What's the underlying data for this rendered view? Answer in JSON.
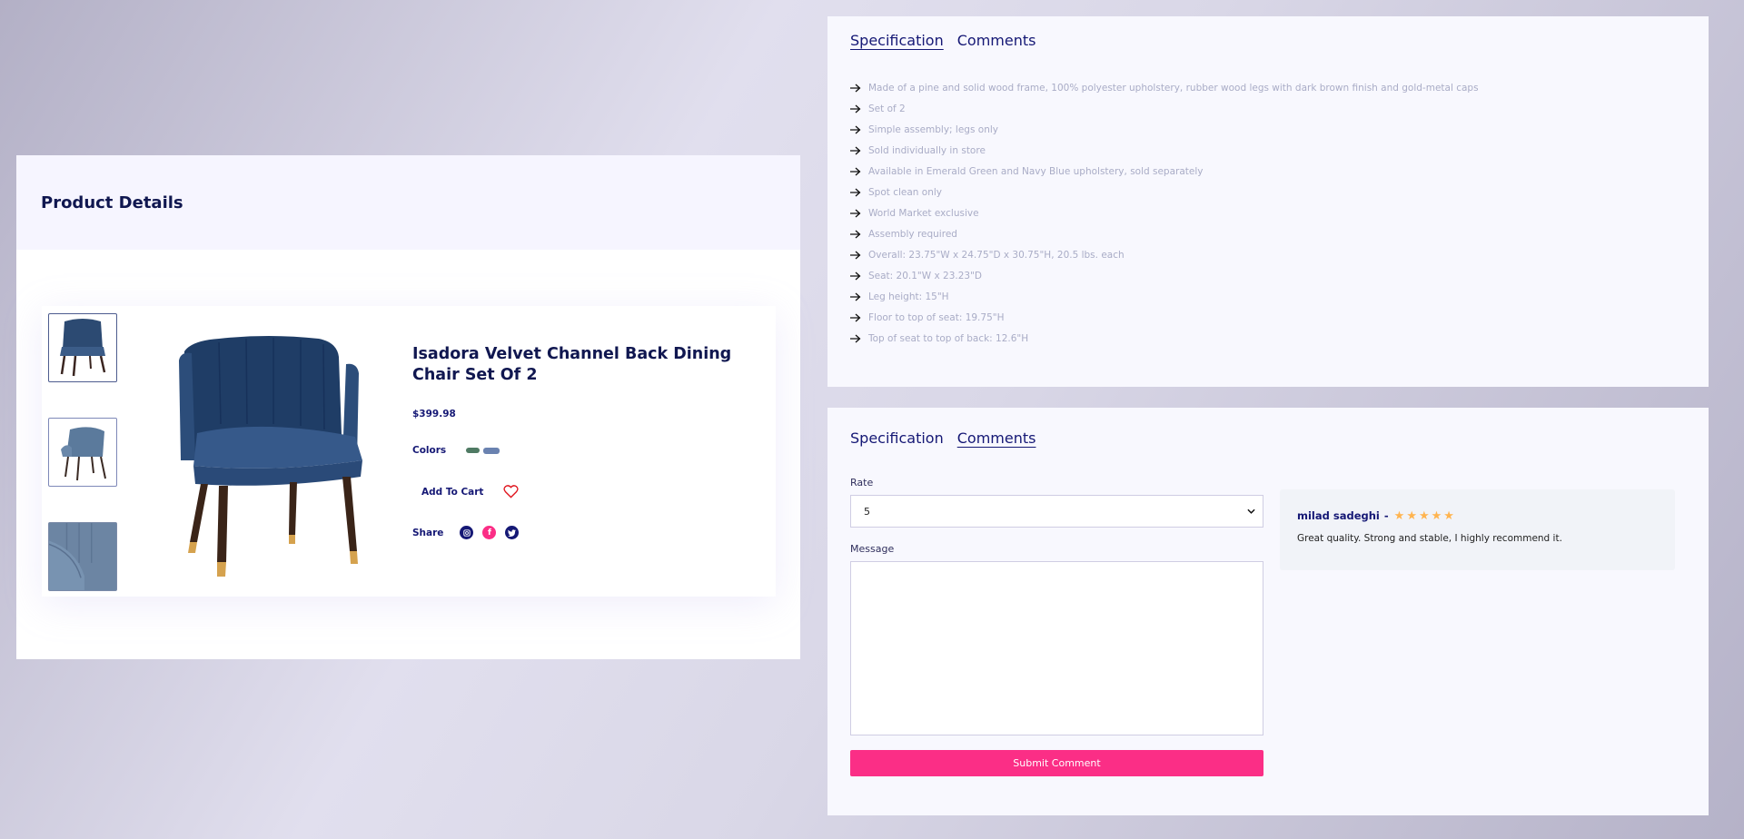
{
  "product_panel": {
    "title": "Product Details",
    "product": {
      "name": "Isadora Velvet Channel Back Dining Chair Set Of 2",
      "price": "$399.98",
      "colors_label": "Colors",
      "colors": [
        "#4f7a63",
        "#6a82b0"
      ],
      "add_to_cart_label": "Add To Cart",
      "share_label": "Share",
      "thumbnails": [
        "front-view",
        "back-view",
        "closeup-view"
      ],
      "wishlist_color": "#e0141d",
      "social_colors": {
        "instagram": "#151875",
        "facebook": "#fb2e86",
        "twitter": "#151875"
      }
    }
  },
  "spec_panel": {
    "tabs": [
      {
        "label": "Specification",
        "active": true
      },
      {
        "label": "Comments",
        "active": false
      }
    ],
    "items": [
      "Made of a pine and solid wood frame, 100% polyester upholstery, rubber wood legs with dark brown finish and gold-metal caps",
      "Set of 2",
      "Simple assembly; legs only",
      "Sold individually in store",
      "Available in Emerald Green and Navy Blue upholstery, sold separately",
      "Spot clean only",
      "World Market exclusive",
      "Assembly required",
      "Overall: 23.75\"W x 24.75\"D x 30.75\"H, 20.5 lbs. each",
      "Seat: 20.1\"W x 23.23\"D",
      "Leg height: 15\"H",
      "Floor to top of seat: 19.75\"H",
      "Top of seat to top of back: 12.6\"H"
    ]
  },
  "comments_panel": {
    "tabs": [
      {
        "label": "Specification",
        "active": false
      },
      {
        "label": "Comments",
        "active": true
      }
    ],
    "form": {
      "rate_label": "Rate",
      "rate_value": "5",
      "message_label": "Message",
      "message_value": "",
      "submit_label": "Submit Comment",
      "submit_color": "#fb2e86"
    },
    "reviews": [
      {
        "author": "milad sadeghi",
        "separator": "-",
        "rating": 5,
        "max_rating": 5,
        "text": "Great quality. Strong and stable, I highly recommend it."
      }
    ]
  }
}
